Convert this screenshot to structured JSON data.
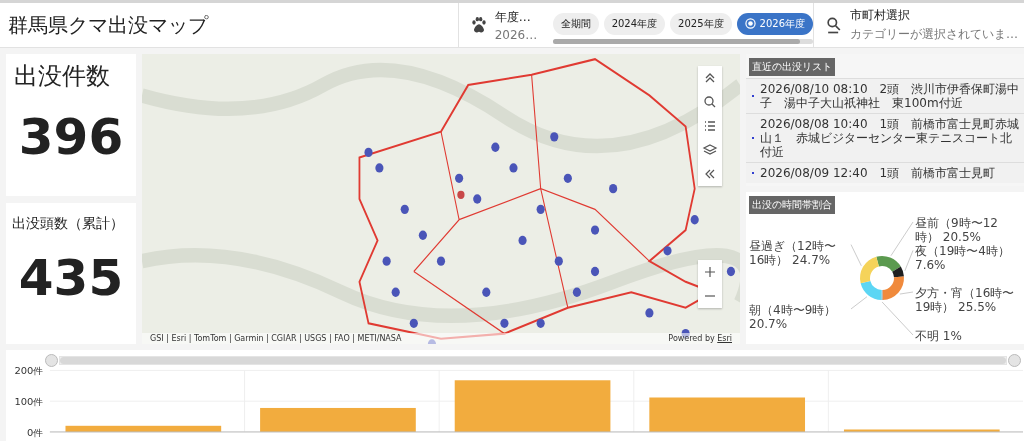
{
  "header": {
    "title": "群馬県クマ出没マップ",
    "year_filter": {
      "label": "年度…",
      "value": "2026…"
    },
    "year_options": [
      {
        "label": "全期間",
        "selected": false
      },
      {
        "label": "2024年度",
        "selected": false
      },
      {
        "label": "2025年度",
        "selected": false
      },
      {
        "label": "2026年度",
        "selected": true
      }
    ],
    "city_filter": {
      "label": "市町村選択",
      "placeholder": "カテゴリーが選択されていま…"
    }
  },
  "kpis": [
    {
      "label": "出没件数",
      "value": "396"
    },
    {
      "label": "出没頭数（累計）",
      "value": "435"
    }
  ],
  "map": {
    "attribution": "GSI | Esri | TomTom | Garmin | CGIAR | USGS | FAO | METI/NASA",
    "powered_by": "Powered by",
    "powered_link": "Esri"
  },
  "recent_list": {
    "title": "直近の出没リスト",
    "items": [
      "2026/08/10 08:10　2頭　渋川市伊香保町湯中子　湯中子大山祇神社　東100m付近",
      "2026/08/08 10:40　1頭　前橋市富士見町赤城山１　赤城ビジターセンター東テニスコート北付近",
      "2026/08/09 12:40　1頭　前橋市富士見町"
    ]
  },
  "time_share": {
    "title": "出没の時間帯割合",
    "chart_data": {
      "type": "donut",
      "categories": [
        "昼前（9時〜12時）",
        "夜（19時〜4時）",
        "夕方・宵（16時〜19時）",
        "不明",
        "朝（4時〜9時）",
        "昼過ぎ（12時〜16時）"
      ],
      "values": [
        20.5,
        7.6,
        25.5,
        1,
        20.7,
        24.7
      ],
      "colors": [
        "#5b9a4f",
        "#1f1f1f",
        "#f08a3c",
        "#9e9e9e",
        "#5cd6f4",
        "#f5d35a"
      ],
      "value_labels": [
        "20.5%",
        "7.6%",
        "25.5%",
        "1%",
        "20.7%",
        "24.7%"
      ]
    }
  },
  "zoom_slider": {
    "level": 1
  },
  "monthly": {
    "chart_data": {
      "type": "bar",
      "ylim": [
        0,
        200
      ],
      "yticks": [
        {
          "value": 0,
          "label": "0件"
        },
        {
          "value": 100,
          "label": "100件"
        },
        {
          "value": 200,
          "label": "200件"
        }
      ],
      "series": [
        {
          "color": "#f2ac3e",
          "values": [
            20,
            78,
            168,
            112,
            8
          ]
        }
      ]
    }
  }
}
